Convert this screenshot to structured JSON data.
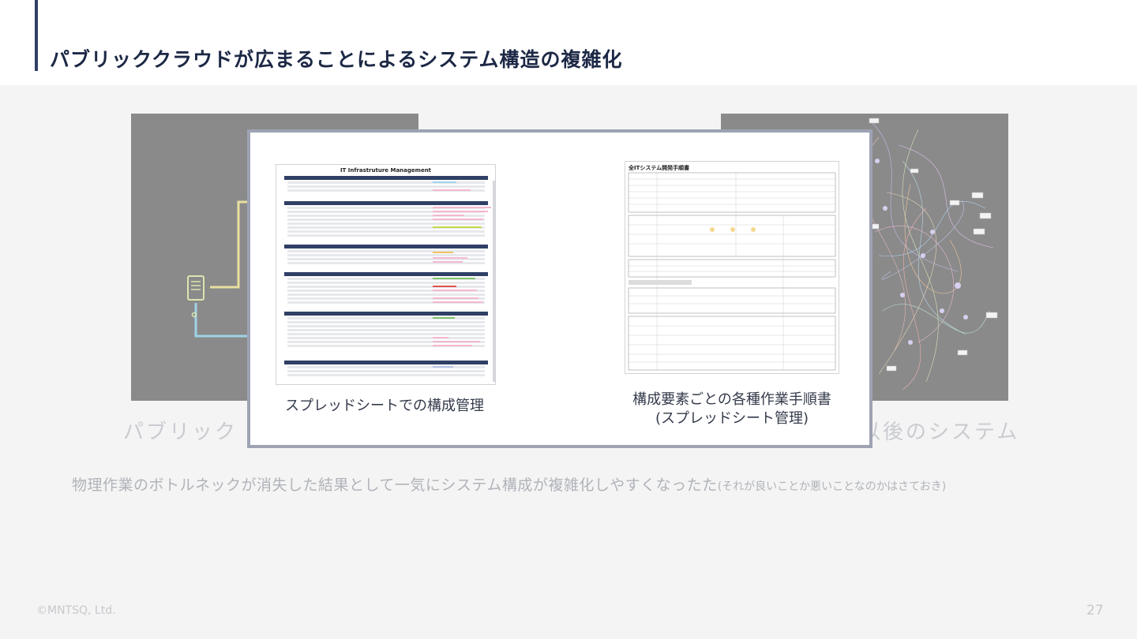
{
  "slide": {
    "title": "パブリッククラウドが広まることによるシステム構造の複雑化",
    "bg_caption_left": "パブリック",
    "bg_caption_right": "ド以後のシステム",
    "subtitle_main": "物理作業のボトルネックが消失した結果として一気にシステム構成が複雑化しやすくなったた",
    "subtitle_note": "(それが良いことか悪いことなのかはさておき)",
    "footer": "©MNTSQ, Ltd.",
    "page_number": "27"
  },
  "modal": {
    "left": {
      "thumbnail_title": "IT Infrastruture Management",
      "caption": "スプレッドシートでの構成管理"
    },
    "right": {
      "thumbnail_title": "全ITシステム開発手順書",
      "caption_line1": "構成要素ごとの各種作業手順書",
      "caption_line2": "(スプレッドシート管理)"
    }
  },
  "colors": {
    "accent": "#2f3f66",
    "title": "#1c2845",
    "modal_border": "#9da3b3",
    "panel_gray": "#8a8a8a"
  },
  "icons": {
    "server": "server-icon",
    "network_graph": "network-graph"
  }
}
